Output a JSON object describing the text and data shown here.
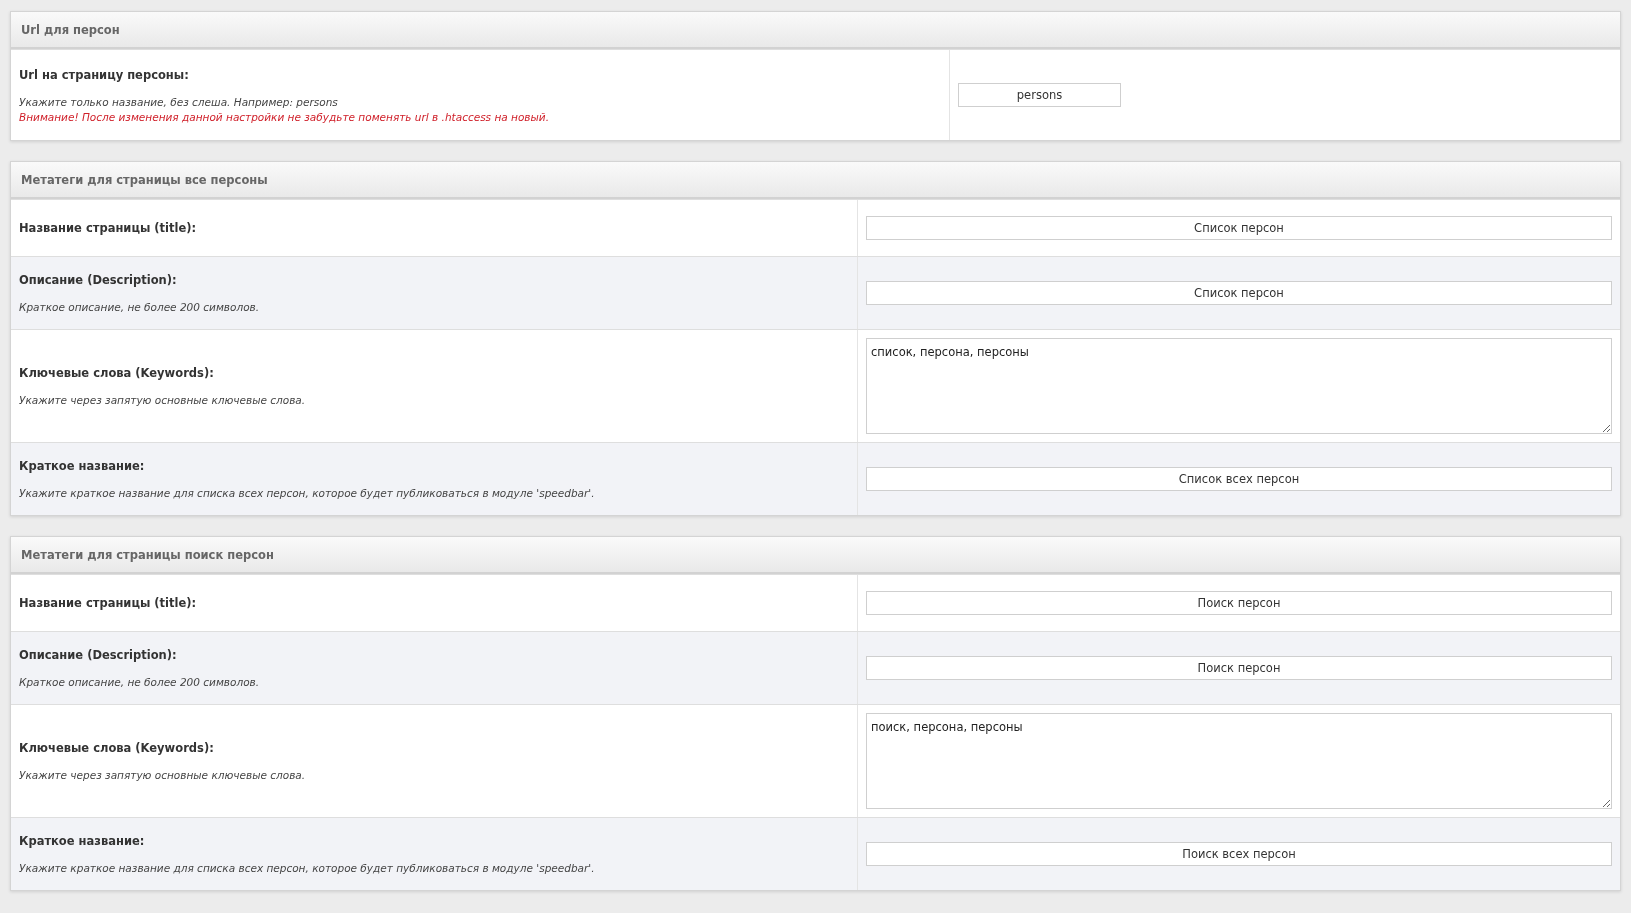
{
  "panels": [
    {
      "title": "Url для персон",
      "rows": [
        {
          "label": "Url на страницу персоны:",
          "hints": [
            {
              "kind": "note",
              "text": "Укажите только название, без слеша. Например: persons"
            },
            {
              "kind": "warning",
              "text": "Внимание! После изменения данной настройки не забудьте поменять url в .htaccess на новый."
            }
          ],
          "field": {
            "kind": "short-input",
            "value": "persons"
          }
        }
      ]
    },
    {
      "title": "Метатеги для страницы все персоны",
      "rows": [
        {
          "label": "Название страницы (title):",
          "hints": [],
          "field": {
            "kind": "input",
            "value": "Список персон"
          }
        },
        {
          "label": "Описание (Description):",
          "hints": [
            {
              "kind": "note",
              "text": "Краткое описание, не более 200 символов."
            }
          ],
          "field": {
            "kind": "input",
            "value": "Список персон"
          }
        },
        {
          "label": "Ключевые слова (Keywords):",
          "hints": [
            {
              "kind": "note",
              "text": "Укажите через запятую основные ключевые слова."
            }
          ],
          "field": {
            "kind": "textarea",
            "value": "список, персона, персоны"
          }
        },
        {
          "label": "Краткое название:",
          "hints": [
            {
              "kind": "note",
              "text": "Укажите краткое название для списка всех персон, которое будет публиковаться в модуле 'speedbar'."
            }
          ],
          "field": {
            "kind": "input",
            "value": "Список всех персон"
          }
        }
      ]
    },
    {
      "title": "Метатеги для страницы поиск персон",
      "rows": [
        {
          "label": "Название страницы (title):",
          "hints": [],
          "field": {
            "kind": "input",
            "value": "Поиск персон"
          }
        },
        {
          "label": "Описание (Description):",
          "hints": [
            {
              "kind": "note",
              "text": "Краткое описание, не более 200 символов."
            }
          ],
          "field": {
            "kind": "input",
            "value": "Поиск персон"
          }
        },
        {
          "label": "Ключевые слова (Keywords):",
          "hints": [
            {
              "kind": "note",
              "text": "Укажите через запятую основные ключевые слова."
            }
          ],
          "field": {
            "kind": "textarea",
            "value": "поиск, персона, персоны"
          }
        },
        {
          "label": "Краткое название:",
          "hints": [
            {
              "kind": "note",
              "text": "Укажите краткое название для списка всех персон, которое будет публиковаться в модуле 'speedbar'."
            }
          ],
          "field": {
            "kind": "input",
            "value": "Поиск всех персон"
          }
        }
      ]
    }
  ]
}
